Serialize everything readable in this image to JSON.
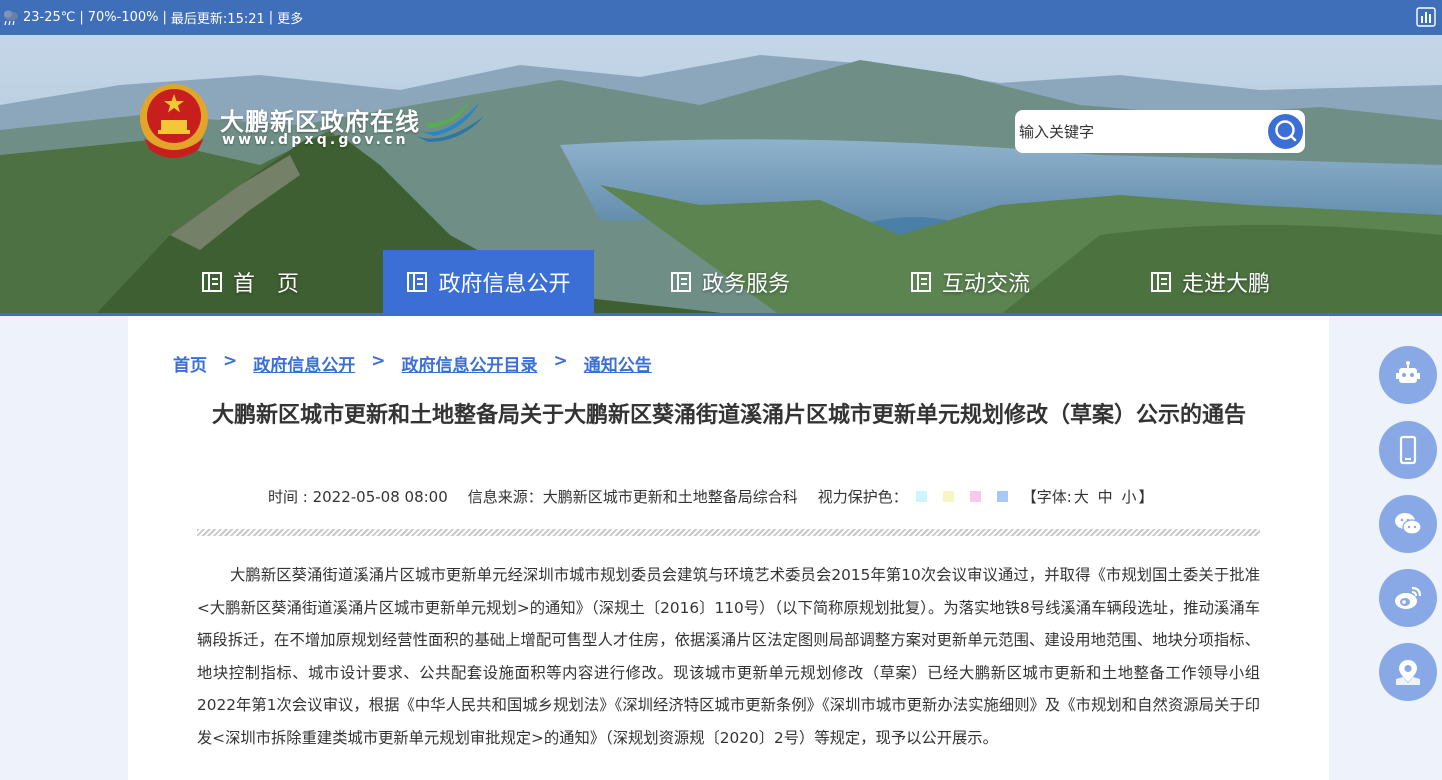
{
  "topbar": {
    "weather_icon": "cloud-rain-icon",
    "temperature": "23-25℃",
    "humidity": "70%-100%",
    "updated": "最后更新:15:21",
    "more": "更多",
    "sep": "|"
  },
  "site": {
    "name": "大鹏新区政府在线",
    "url": "www.dpxq.gov.cn"
  },
  "search": {
    "placeholder": "输入关键字",
    "icon": "search-icon"
  },
  "nav": {
    "items": [
      {
        "label": "首　页"
      },
      {
        "label": "政府信息公开"
      },
      {
        "label": "政务服务"
      },
      {
        "label": "互动交流"
      },
      {
        "label": "走进大鹏"
      }
    ],
    "active_index": 1,
    "accent_color": "#3b6fd6"
  },
  "breadcrumb": {
    "items": [
      "首页",
      "政府信息公开",
      "政府信息公开目录",
      "通知公告"
    ],
    "separator": ">"
  },
  "article": {
    "title": "大鹏新区城市更新和土地整备局关于大鹏新区葵涌街道溪涌片区城市更新单元规划修改（草案）公示的通告",
    "time_label": "时间 : 2022-05-08 08:00",
    "source_label": "信息来源：大鹏新区城市更新和土地整备局综合科",
    "eye_protect_label": "视力保护色：",
    "eye_colors": [
      "#cdf6fb",
      "#f7f6c3",
      "#f9c8f0",
      "#a8c9f5"
    ],
    "font_open": "【字体:",
    "font_sizes": [
      "大",
      "中",
      "小"
    ],
    "font_close": "】",
    "body": "大鹏新区葵涌街道溪涌片区城市更新单元经深圳市城市规划委员会建筑与环境艺术委员会2015年第10次会议审议通过，并取得《市规划国土委关于批准<大鹏新区葵涌街道溪涌片区城市更新单元规划>的通知》（深规土〔2016〕110号）（以下简称原规划批复）。为落实地铁8号线溪涌车辆段选址，推动溪涌车辆段拆迁，在不增加原规划经营性面积的基础上增配可售型人才住房，依据溪涌片区法定图则局部调整方案对更新单元范围、建设用地范围、地块分项指标、地块控制指标、城市设计要求、公共配套设施面积等内容进行修改。现该城市更新单元规划修改（草案）已经大鹏新区城市更新和土地整备工作领导小组2022年第1次会议审议，根据《中华人民共和国城乡规划法》《深圳经济特区城市更新条例》《深圳市城市更新办法实施细则》及《市规划和自然资源局关于印发<深圳市拆除重建类城市更新单元规划审批规定>的通知》（深规划资源规〔2020〕2号）等规定，现予以公开展示。"
  },
  "side_tools": [
    "robot-icon",
    "mobile-icon",
    "wechat-icon",
    "weibo-icon",
    "map-location-icon"
  ]
}
